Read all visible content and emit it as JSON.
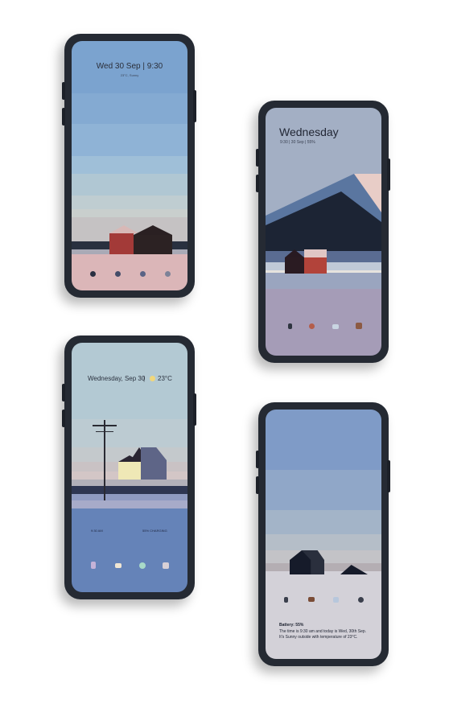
{
  "phone1": {
    "date_time": "Wed 30 Sep  |  9:30",
    "weather": "23°C, Sunny"
  },
  "phone2": {
    "day": "Wednesday",
    "status": "9:30   |   30 Sep   |   55%"
  },
  "phone3": {
    "date": "Wednesday, Sep 30",
    "temp": "23°C",
    "time": "9:30 AM",
    "battery": "55% CHARGING"
  },
  "phone4": {
    "battery": "Battery: 55%",
    "line1": "The time is 9:30 am and today is Wed, 30th Sep.",
    "line2": "It's Sunny outside with temperature of 23°C."
  }
}
